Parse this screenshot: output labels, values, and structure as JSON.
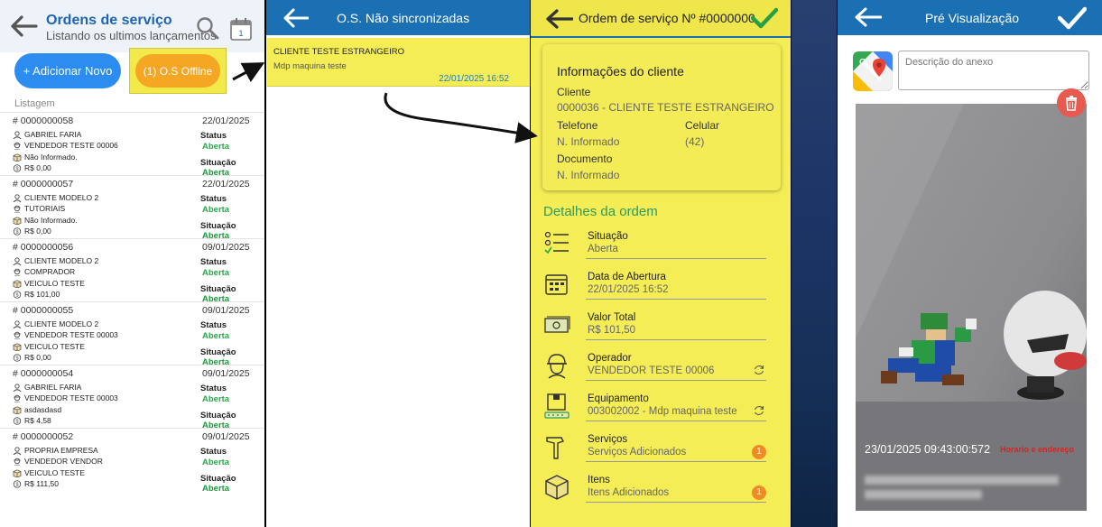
{
  "panel1": {
    "title": "Ordens de serviço",
    "subtitle": "Listando os ultimos lançamentos",
    "calendar_day": "1",
    "add_button": "+ Adicionar Novo",
    "offline_button": "(1) O.S Offline",
    "list_label": "Listagem",
    "status_label": "Status",
    "situacao_label": "Situação",
    "orders": [
      {
        "num": "# 0000000058",
        "date": "22/01/2025",
        "client": "GABRIEL FARIA",
        "seller": "VENDEDOR TESTE 00006",
        "item": "Não Informado.",
        "value": "R$ 0,00",
        "status": "Aberta",
        "situacao": "Aberta"
      },
      {
        "num": "# 0000000057",
        "date": "22/01/2025",
        "client": "CLIENTE MODELO 2",
        "seller": "TUTORIAIS",
        "item": "Não Informado.",
        "value": "R$ 0,00",
        "status": "Aberta",
        "situacao": "Aberta"
      },
      {
        "num": "# 0000000056",
        "date": "09/01/2025",
        "client": "CLIENTE MODELO 2",
        "seller": "COMPRADOR",
        "item": "VEICULO TESTE",
        "value": "R$ 101,00",
        "status": "Aberta",
        "situacao": "Aberta"
      },
      {
        "num": "# 0000000055",
        "date": "09/01/2025",
        "client": "CLIENTE MODELO 2",
        "seller": "VENDEDOR TESTE 00003",
        "item": "VEICULO TESTE",
        "value": "R$ 0,00",
        "status": "Aberta",
        "situacao": "Aberta"
      },
      {
        "num": "# 0000000054",
        "date": "09/01/2025",
        "client": "GABRIEL FARIA",
        "seller": "VENDEDOR TESTE 00003",
        "item": "asdasdasd",
        "value": "R$ 4,58",
        "status": "Aberta",
        "situacao": "Aberta"
      },
      {
        "num": "# 0000000052",
        "date": "09/01/2025",
        "client": "PROPRIA EMPRESA",
        "seller": "VENDEDOR VENDOR",
        "item": "VEICULO TESTE",
        "value": "R$ 111,50",
        "status": "Aberta",
        "situacao": "Aberta"
      }
    ]
  },
  "panel2": {
    "title": "O.S. Não sincronizadas",
    "card": {
      "client": "CLIENTE TESTE ESTRANGEIRO",
      "equipment": "Mdp maquina teste",
      "datetime": "22/01/2025 16:52"
    }
  },
  "panel3": {
    "title": "Ordem de serviço Nº #0000000",
    "info_title": "Informações do cliente",
    "cliente_label": "Cliente",
    "cliente_value": "0000036 - CLIENTE TESTE ESTRANGEIRO",
    "telefone_label": "Telefone",
    "telefone_value": "N. Informado",
    "celular_label": "Celular",
    "celular_value": "(42)",
    "documento_label": "Documento",
    "documento_value": "N. Informado",
    "details_title": "Detalhes da ordem",
    "details": [
      {
        "label": "Situação",
        "value": "Aberta"
      },
      {
        "label": "Data de Abertura",
        "value": "22/01/2025 16:52"
      },
      {
        "label": "Valor Total",
        "value": "R$ 101,50"
      },
      {
        "label": "Operador",
        "value": "VENDEDOR TESTE 00006"
      },
      {
        "label": "Equipamento",
        "value": "003002002 - Mdp maquina teste"
      },
      {
        "label": "Serviços",
        "value": "Serviços Adicionados",
        "badge": "1"
      },
      {
        "label": "Itens",
        "value": "Itens Adicionados",
        "badge": "1"
      }
    ]
  },
  "panel4": {
    "title": "Pré Visualização",
    "description_placeholder": "Descrição do anexo",
    "timestamp": "23/01/2025 09:43:00:572",
    "annotation": "Horario e endereço"
  },
  "colors": {
    "primary_blue": "#1b6fb3",
    "button_blue": "#2d8cf0",
    "offline_orange": "#f5a623",
    "highlight_yellow": "#f5ed56",
    "status_green": "#2aa84a",
    "section_green": "#2a9a64",
    "badge_orange": "#f08a24",
    "trash_red": "#e85a4f"
  }
}
